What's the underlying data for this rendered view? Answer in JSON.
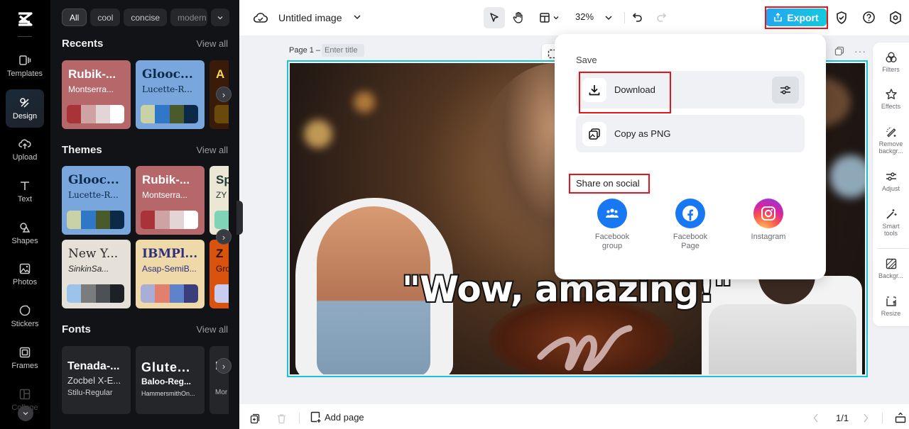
{
  "rail": {
    "items": [
      {
        "label": "Templates",
        "icon": "templates-icon"
      },
      {
        "label": "Design",
        "icon": "design-icon",
        "active": true
      },
      {
        "label": "Upload",
        "icon": "upload-icon"
      },
      {
        "label": "Text",
        "icon": "text-icon"
      },
      {
        "label": "Shapes",
        "icon": "shapes-icon"
      },
      {
        "label": "Photos",
        "icon": "photos-icon"
      },
      {
        "label": "Stickers",
        "icon": "stickers-icon"
      },
      {
        "label": "Frames",
        "icon": "frames-icon"
      },
      {
        "label": "Collage",
        "icon": "collage-icon"
      }
    ]
  },
  "panel": {
    "chips": [
      "All",
      "cool",
      "concise",
      "modern"
    ],
    "recents": {
      "title": "Recents",
      "view_all": "View all",
      "cards": [
        {
          "t1": "Rubik-...",
          "t2": "Montserra...",
          "bg": "#b5676a",
          "fg": "#ffffff",
          "swatches": [
            "#a8343a",
            "#cfa3a3",
            "#e3d5d5",
            "#ffffff"
          ]
        },
        {
          "t1": "Glooc...",
          "t2": "Lucette-R...",
          "bg": "#7aa6de",
          "fg": "#0b2a48",
          "swatches": [
            "#c9d2a6",
            "#2f78c8",
            "#4b5a2b",
            "#0b2a48"
          ]
        },
        {
          "t1": "A",
          "t2": "",
          "bg": "#3a1a08",
          "fg": "#f2d65c",
          "swatches": [
            "#6a4a0c"
          ]
        }
      ]
    },
    "themes": {
      "title": "Themes",
      "view_all": "View all",
      "cards": [
        {
          "t1": "Glooc...",
          "t2": "Lucette-R...",
          "bg": "#7aa6de",
          "fg": "#0b2a48",
          "swatches": [
            "#c9d2a6",
            "#2f78c8",
            "#4b5a2b",
            "#0b2a48"
          ]
        },
        {
          "t1": "Rubik-...",
          "t2": "Montserra...",
          "bg": "#b5676a",
          "fg": "#ffffff",
          "swatches": [
            "#a8343a",
            "#cfa3a3",
            "#e3d5d5",
            "#ffffff"
          ]
        },
        {
          "t1": "Sp",
          "t2": "ZY",
          "bg": "#ece6d5",
          "fg": "#1c3c35",
          "swatches": [
            "#7fd3b6"
          ]
        },
        {
          "t1": "New Y...",
          "t2": "SinkinSa...",
          "bg": "#e5e0d8",
          "fg": "#2a2a2a",
          "swatches": [
            "#9cc3ea",
            "#7a7c7e",
            "#4d5055",
            "#1d2024"
          ]
        },
        {
          "t1": "IBMPl...",
          "t2": "Asap-SemiB...",
          "bg": "#f0d9a8",
          "fg": "#2c2f80",
          "swatches": [
            "#aaaed6",
            "#e2806e",
            "#5f82cc",
            "#3a3f7c"
          ]
        },
        {
          "t1": "Z",
          "t2": "Gro",
          "bg": "#d9530e",
          "fg": "#2a1208",
          "swatches": [
            "#c9ccf0"
          ]
        }
      ]
    },
    "fonts": {
      "title": "Fonts",
      "view_all": "View all",
      "cards": [
        {
          "t1": "Tenada-...",
          "t2": "Zocbel X-E...",
          "t3": "Stilu-Regular"
        },
        {
          "t1": "Glute...",
          "t2": "Baloo-Reg...",
          "t3": "HammersmithOn..."
        },
        {
          "t1": "Ru",
          "t2": "",
          "t3": "Mor"
        }
      ]
    }
  },
  "topbar": {
    "title": "Untitled image",
    "zoom": "32%",
    "export_label": "Export"
  },
  "canvas": {
    "page_label": "Page 1 –",
    "page_title_placeholder": "Enter title",
    "caption": "\"Wow, amazing!\""
  },
  "export_menu": {
    "save_label": "Save",
    "download_label": "Download",
    "copy_label": "Copy as PNG",
    "share_label": "Share on social",
    "social": [
      {
        "label": "Facebook group",
        "color": "#1877f2"
      },
      {
        "label": "Facebook Page",
        "color": "#1877f2"
      },
      {
        "label": "Instagram",
        "color": "#e1306c"
      }
    ]
  },
  "right_tools": [
    {
      "label": "Filters"
    },
    {
      "label": "Effects"
    },
    {
      "label": "Remove backgr..."
    },
    {
      "label": "Adjust"
    },
    {
      "label": "Smart tools"
    },
    {
      "label": "Backgr..."
    },
    {
      "label": "Resize"
    }
  ],
  "bottombar": {
    "add_page": "Add page",
    "pager": "1/1"
  }
}
